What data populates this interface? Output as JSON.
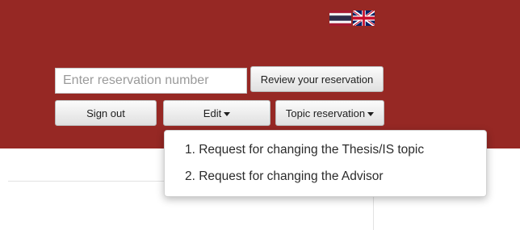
{
  "language_flags": [
    {
      "icon": "thailand-flag-icon",
      "language": "Thai"
    },
    {
      "icon": "uk-flag-icon",
      "language": "English"
    }
  ],
  "reservation": {
    "placeholder": "Enter reservation number",
    "value": "",
    "review_button": "Review your reservation"
  },
  "toolbar": {
    "sign_out": "Sign out",
    "edit": "Edit",
    "topic_reservation": "Topic reservation"
  },
  "topic_menu": {
    "items": [
      {
        "label": "1. Request for changing the Thesis/IS topic"
      },
      {
        "label": "2. Request for changing the Advisor"
      }
    ]
  },
  "colors": {
    "header_background": "#962824",
    "button_gradient_top": "#fbfbfb",
    "button_gradient_bottom": "#e0e0e0"
  }
}
